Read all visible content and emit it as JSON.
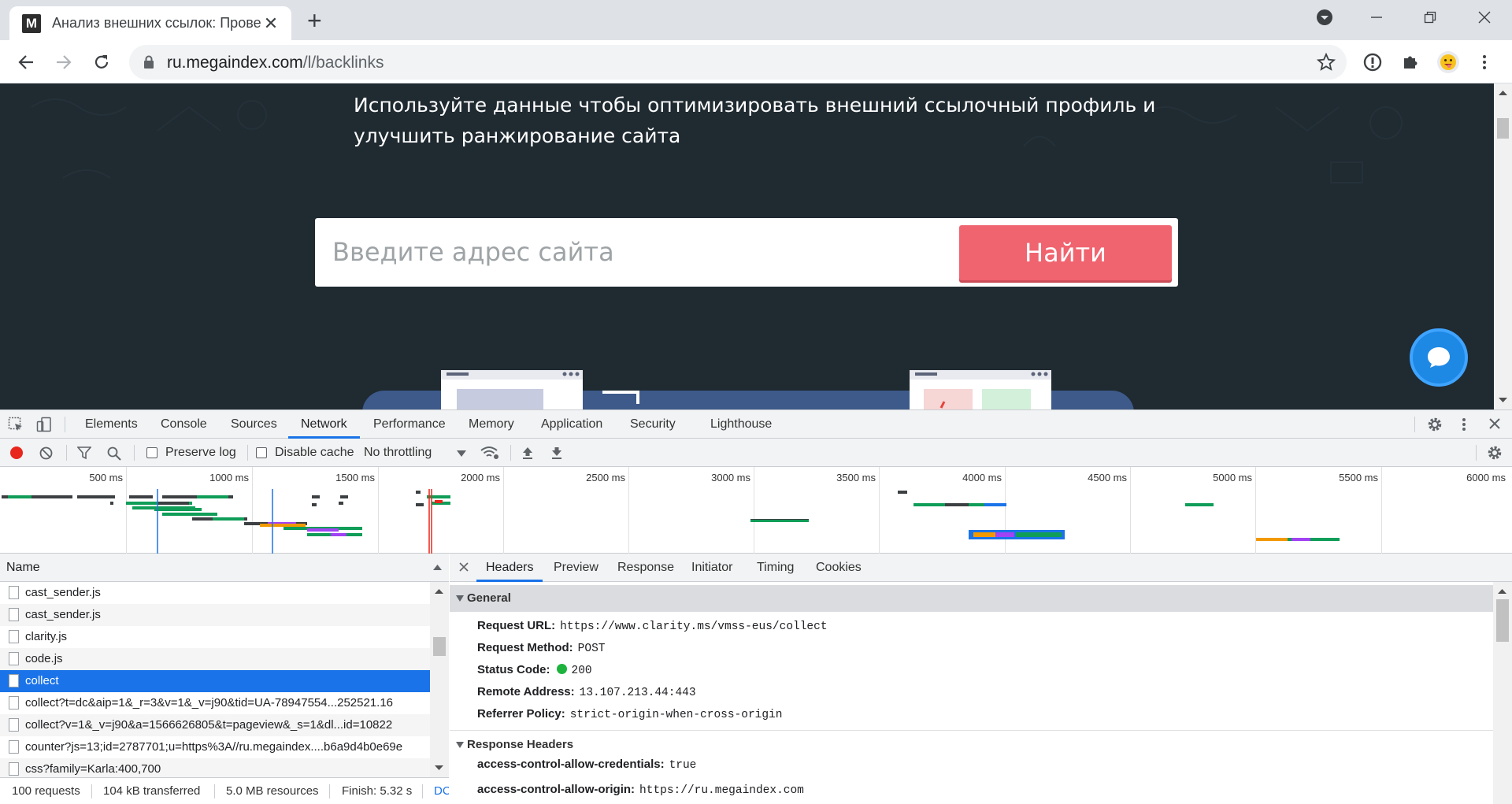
{
  "browser": {
    "tab_title": "Анализ внешних ссылок: Прове",
    "favicon_letter": "M",
    "url_host": "ru.megaindex.com",
    "url_path": "/l/backlinks"
  },
  "page": {
    "text_line_1": "Используйте данные чтобы оптимизировать внешний ссылочный профиль и",
    "text_line_2": "улучшить ранжирование сайта",
    "search_placeholder": "Введите адрес сайта",
    "find_button": "Найти",
    "colors": {
      "background": "#1f2a31",
      "accent": "#f0646f",
      "chat": "#1e88e5"
    }
  },
  "devtools": {
    "tabs": [
      "Elements",
      "Console",
      "Sources",
      "Network",
      "Performance",
      "Memory",
      "Application",
      "Security",
      "Lighthouse"
    ],
    "active_tab": "Network",
    "toolbar": {
      "preserve_log": "Preserve log",
      "disable_cache": "Disable cache",
      "throttling": "No throttling"
    },
    "timeline_ticks": [
      "500 ms",
      "1000 ms",
      "1500 ms",
      "2000 ms",
      "2500 ms",
      "3000 ms",
      "3500 ms",
      "4000 ms",
      "4500 ms",
      "5000 ms",
      "5500 ms",
      "6000 ms"
    ],
    "list_header": "Name",
    "requests": [
      "cast_sender.js",
      "cast_sender.js",
      "clarity.js",
      "code.js",
      "collect",
      "collect?t=dc&aip=1&_r=3&v=1&_v=j90&tid=UA-78947554...252521.16",
      "collect?v=1&_v=j90&a=1566626805&t=pageview&_s=1&dl...id=10822",
      "counter?js=13;id=2787701;u=https%3A//ru.megaindex....b6a9d4b0e69e",
      "css?family=Karla:400,700"
    ],
    "selected_request": "collect",
    "detail_tabs": [
      "Headers",
      "Preview",
      "Response",
      "Initiator",
      "Timing",
      "Cookies"
    ],
    "active_detail_tab": "Headers",
    "general": {
      "title": "General",
      "request_url_label": "Request URL:",
      "request_url": "https://www.clarity.ms/vmss-eus/collect",
      "request_method_label": "Request Method:",
      "request_method": "POST",
      "status_code_label": "Status Code:",
      "status_code": "200",
      "remote_address_label": "Remote Address:",
      "remote_address": "13.107.213.44:443",
      "referrer_policy_label": "Referrer Policy:",
      "referrer_policy": "strict-origin-when-cross-origin"
    },
    "response_headers": {
      "title": "Response Headers",
      "h1_label": "access-control-allow-credentials:",
      "h1_value": "true",
      "h2_label": "access-control-allow-origin:",
      "h2_value": "https://ru.megaindex.com"
    },
    "status": {
      "requests": "100 requests",
      "transferred": "104 kB transferred",
      "resources": "5.0 MB resources",
      "finish": "Finish: 5.32 s",
      "dcl": "DC"
    }
  }
}
